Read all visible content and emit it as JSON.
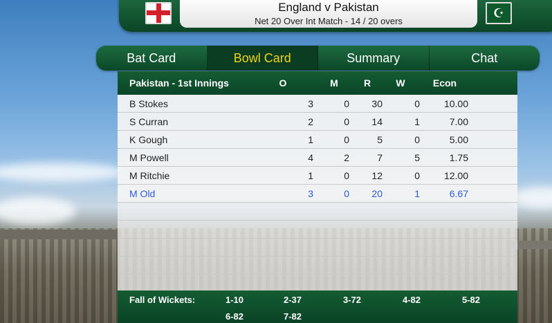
{
  "match": {
    "title": "England v Pakistan",
    "subtitle": "Net 20 Over Int Match - 14 / 20 overs",
    "home_flag": "england-flag",
    "away_flag": "pakistan-flag",
    "away_flag_glyph": "☪"
  },
  "tabs": [
    {
      "label": "Bat Card"
    },
    {
      "label": "Bowl Card",
      "active": true
    },
    {
      "label": "Summary"
    },
    {
      "label": "Chat"
    }
  ],
  "table": {
    "innings_label": "Pakistan - 1st Innings",
    "headers": {
      "o": "O",
      "m": "M",
      "r": "R",
      "w": "W",
      "econ": "Econ"
    },
    "rows": [
      {
        "name": "B Stokes",
        "o": "3",
        "m": "0",
        "r": "30",
        "w": "0",
        "econ": "10.00"
      },
      {
        "name": "S Curran",
        "o": "2",
        "m": "0",
        "r": "14",
        "w": "1",
        "econ": "7.00"
      },
      {
        "name": "K Gough",
        "o": "1",
        "m": "0",
        "r": "5",
        "w": "0",
        "econ": "5.00"
      },
      {
        "name": "M Powell",
        "o": "4",
        "m": "2",
        "r": "7",
        "w": "5",
        "econ": "1.75"
      },
      {
        "name": "M Ritchie",
        "o": "1",
        "m": "0",
        "r": "12",
        "w": "0",
        "econ": "12.00"
      },
      {
        "name": "M Old",
        "o": "3",
        "m": "0",
        "r": "20",
        "w": "1",
        "econ": "6.67",
        "current": true
      }
    ]
  },
  "fall_of_wickets": {
    "label": "Fall of Wickets:",
    "items": [
      "1-10",
      "2-37",
      "3-72",
      "4-82",
      "5-82",
      "6-82",
      "7-82"
    ]
  },
  "colors": {
    "header_green": "#0a4527",
    "active_tab_text": "#f2d21b",
    "current_bowler_text": "#2c5bd6"
  }
}
